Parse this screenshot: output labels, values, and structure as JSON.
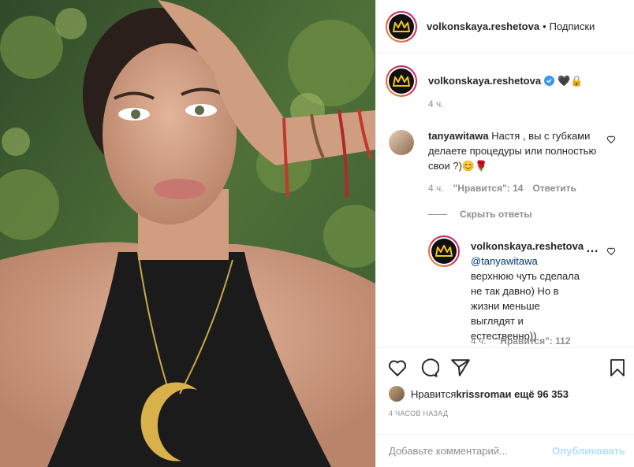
{
  "post": {
    "author": "volkonskaya.reshetova",
    "follow_label": "Подписки",
    "dot": "•",
    "caption_emoji": "🖤🔒",
    "caption_time": "4 ч."
  },
  "comments": [
    {
      "user": "tanyawitawa",
      "text": "Настя , вы с губками делаете процедуры или полностью свои ?)😊🌹",
      "time": "4 ч.",
      "likes": "\"Нравится\": 14",
      "reply_label": "Ответить",
      "hide_replies": "Скрыть ответы"
    },
    {
      "user": "volkonskaya.reshetova",
      "mention": "@tanyawitawa",
      "text": " верхнюю чуть сделала не так давно) Но в жизни меньше выглядят и естественно))",
      "time": "4 ч.",
      "likes": "\"Нравится\": 112"
    }
  ],
  "actions": {
    "liked_by_prefix": "Нравится ",
    "liked_by_user": "krissroma",
    "liked_by_suffix": " и ещё 96 353",
    "time_ago": "4 часов назад"
  },
  "composer": {
    "placeholder": "Добавьте комментарий...",
    "publish_label": "Опубликовать"
  },
  "colors": {
    "brand_gold": "#f5c518",
    "link": "#00376b",
    "publish_disabled": "#b2dffc",
    "verified": "#3897f0"
  },
  "icons": [
    "heart-icon",
    "comment-icon",
    "share-icon",
    "bookmark-icon",
    "more-icon",
    "verified-icon",
    "crown-logo"
  ]
}
